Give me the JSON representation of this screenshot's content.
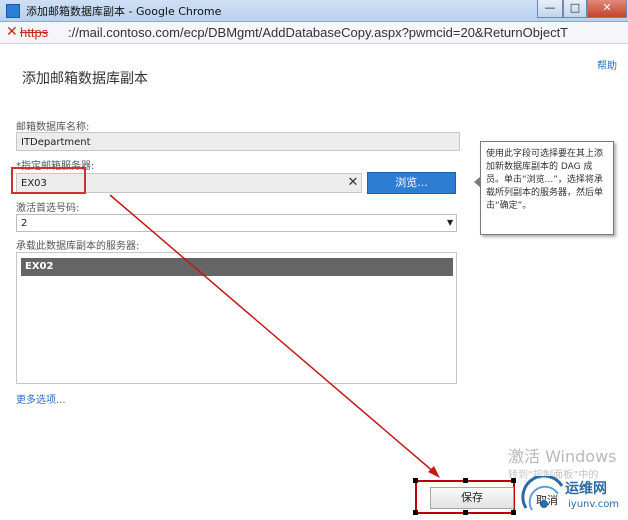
{
  "window": {
    "title": "添加邮箱数据库副本 - Google Chrome",
    "controls": {
      "minimize": "—",
      "maximize": "□",
      "close": "✕"
    }
  },
  "address_bar": {
    "insecure_mark": "✕",
    "scheme": "https",
    "url_rest": "://mail.contoso.com/ecp/DBMgmt/AddDatabaseCopy.aspx?pwmcid=20&ReturnObjectT"
  },
  "page": {
    "title": "添加邮箱数据库副本",
    "help_link": "帮助"
  },
  "form": {
    "db_name_label": "邮箱数据库名称:",
    "db_name_value": "ITDepartment",
    "server_label": "*指定邮箱服务器:",
    "server_value": "EX03",
    "clear_button": "✕",
    "browse_button": "浏览...",
    "activation_label": "激活首选号码:",
    "activation_value": "2",
    "activation_caret": "▼",
    "servers_label": "承载此数据库副本的服务器:",
    "servers": [
      "EX02"
    ],
    "more_options": "更多选项..."
  },
  "callout": {
    "text": "使用此字段可选择要在其上添加新数据库副本的 DAG 成员。单击“浏览...”，选择将承载所列副本的服务器，然后单击“确定”。"
  },
  "footer": {
    "save_button": "保存",
    "cancel_button": "取消"
  },
  "watermark": {
    "title": "激活 Windows",
    "subtitle": "转到“控制面板”中的"
  },
  "logo": {
    "name": "运维网",
    "domain": "iyunv.com"
  },
  "colors": {
    "accent": "#2f7dd3",
    "highlight_red": "#d03030",
    "selected_row": "#656565"
  },
  "icons": {
    "insecure": "x-mark-icon",
    "clear": "close-icon",
    "dropdown": "chevron-down-icon"
  }
}
